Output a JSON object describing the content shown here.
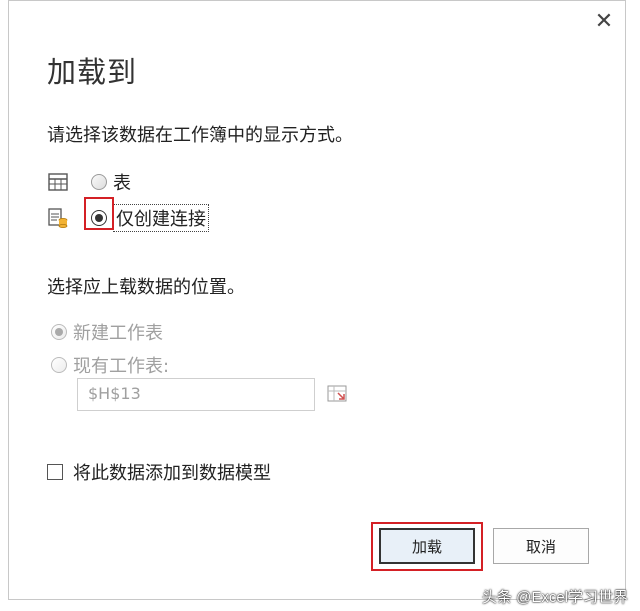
{
  "dialog": {
    "title": "加载到",
    "close_icon": "close-icon",
    "prompt_view": "请选择该数据在工作簿中的显示方式。",
    "view_options": [
      {
        "label": "表",
        "icon": "table-icon",
        "checked": false
      },
      {
        "label": "仅创建连接",
        "icon": "connection-icon",
        "checked": true
      }
    ],
    "prompt_location": "选择应上载数据的位置。",
    "location_options": [
      {
        "label": "新建工作表",
        "checked": true,
        "disabled": true
      },
      {
        "label": "现有工作表:",
        "checked": false,
        "disabled": true
      }
    ],
    "cell_reference": "$H$13",
    "add_to_model_label": "将此数据添加到数据模型",
    "add_to_model_checked": false,
    "load_button": "加载",
    "cancel_button": "取消"
  },
  "watermark": "头条 @Excel学习世界",
  "colors": {
    "highlight": "#d42025",
    "disabled_text": "#a0a0a0"
  }
}
